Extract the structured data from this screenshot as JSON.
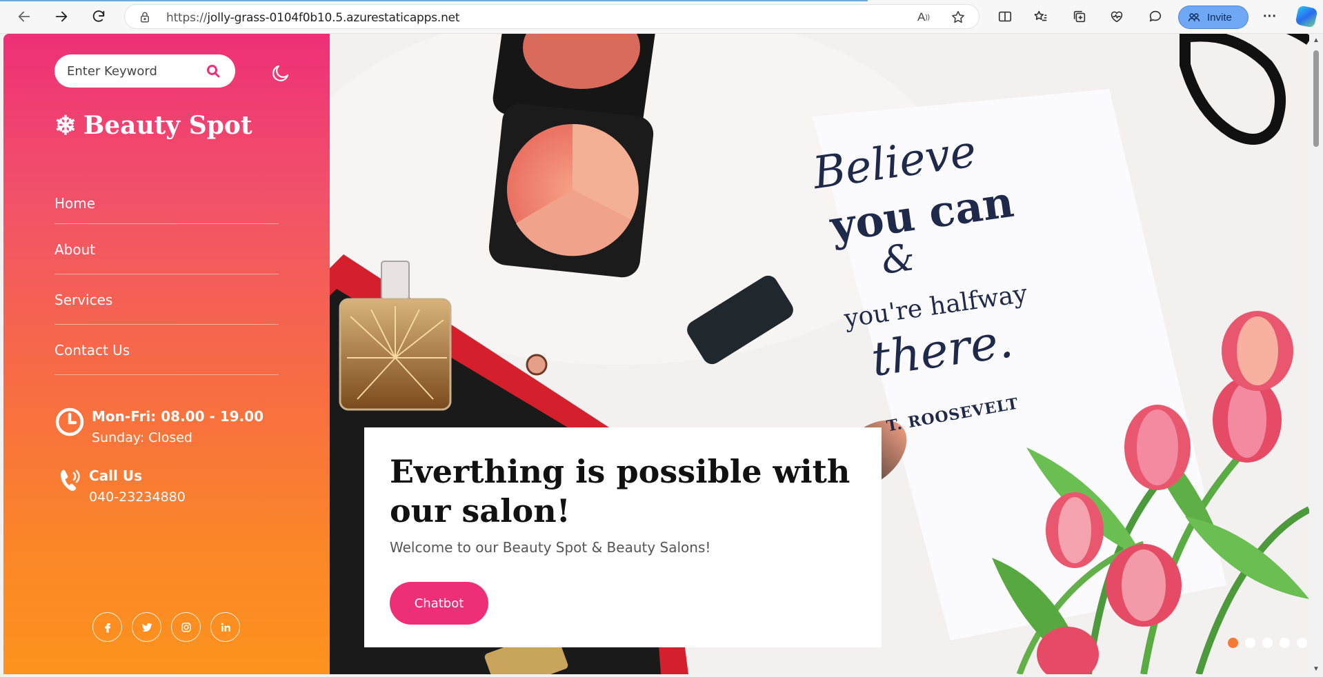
{
  "browser": {
    "url_scheme": "https://",
    "url_host": "jolly-grass-0104f0b10.5.azurestaticapps.net",
    "invite_label": "Invite"
  },
  "sidebar": {
    "search_placeholder": "Enter Keyword",
    "brand": "Beauty Spot",
    "menu": [
      "Home",
      "About",
      "Services",
      "Contact Us"
    ],
    "hours": {
      "title": "Mon-Fri: 08.00 - 19.00",
      "sub": "Sunday: Closed"
    },
    "call": {
      "title": "Call Us",
      "phone": "040-23234880"
    },
    "socials": [
      "facebook-icon",
      "twitter-icon",
      "instagram-icon",
      "linkedin-icon"
    ]
  },
  "hero": {
    "quote": {
      "line1": "Believe",
      "line2": "you can",
      "amp": "&",
      "line3": "you're halfway",
      "line4": "there.",
      "author": "T. ROOSEVELT"
    },
    "headline": "Everthing is possible with our salon!",
    "subtitle": "Welcome to our Beauty Spot & Beauty Salons!",
    "cta": "Chatbot",
    "slides": 5,
    "active_slide": 1
  },
  "colors": {
    "accent": "#ee2f77",
    "gradient_top": "#ee2f77",
    "gradient_bottom": "#fd931d"
  }
}
